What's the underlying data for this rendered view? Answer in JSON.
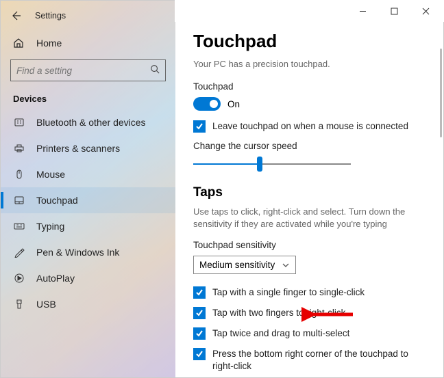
{
  "app": {
    "title": "Settings"
  },
  "home": {
    "label": "Home"
  },
  "search": {
    "placeholder": "Find a setting"
  },
  "section": {
    "label": "Devices"
  },
  "nav": {
    "items": [
      {
        "label": "Bluetooth & other devices"
      },
      {
        "label": "Printers & scanners"
      },
      {
        "label": "Mouse"
      },
      {
        "label": "Touchpad"
      },
      {
        "label": "Typing"
      },
      {
        "label": "Pen & Windows Ink"
      },
      {
        "label": "AutoPlay"
      },
      {
        "label": "USB"
      }
    ]
  },
  "page": {
    "title": "Touchpad",
    "subtitle": "Your PC has a precision touchpad.",
    "toggle": {
      "label": "Touchpad",
      "state": "On"
    },
    "leave_on": "Leave touchpad on when a mouse is connected",
    "cursor_speed_label": "Change the cursor speed",
    "taps": {
      "title": "Taps",
      "desc": "Use taps to click, right-click and select. Turn down the sensitivity if they are activated while you're typing",
      "sensitivity_label": "Touchpad sensitivity",
      "sensitivity_value": "Medium sensitivity",
      "checks": [
        "Tap with a single finger to single-click",
        "Tap with two fingers to right-click",
        "Tap twice and drag to multi-select",
        "Press the bottom right corner of the touchpad to right-click"
      ]
    }
  }
}
